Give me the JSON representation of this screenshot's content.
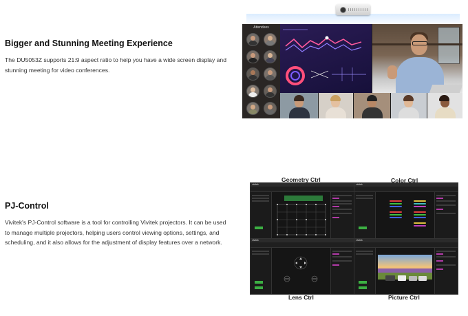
{
  "section1": {
    "title": "Bigger and Stunning Meeting Experience",
    "body": "The DU5053Z supports 21:9 aspect ratio to help you have a wide screen display and stunning meeting for video conferences.",
    "image": {
      "attendees_label": "Attendees"
    }
  },
  "section2": {
    "title": "PJ-Control",
    "body": "Vivitek's PJ-Control software is a tool for controlling Vivitek projectors. It can be used to manage multiple projectors, helping users control viewing options, settings, and scheduling, and it also allows for the adjustment of display features over a network.",
    "panels": [
      {
        "label": "Geometry Ctrl"
      },
      {
        "label": "Color Ctrl"
      },
      {
        "label": "Lens Ctrl"
      },
      {
        "label": "Picture Ctrl"
      }
    ],
    "app_logo": "vivitek"
  },
  "colors": {
    "accent_green": "#3cb043",
    "app_background": "#151515",
    "dashboard_purple": "#2b1c55"
  }
}
